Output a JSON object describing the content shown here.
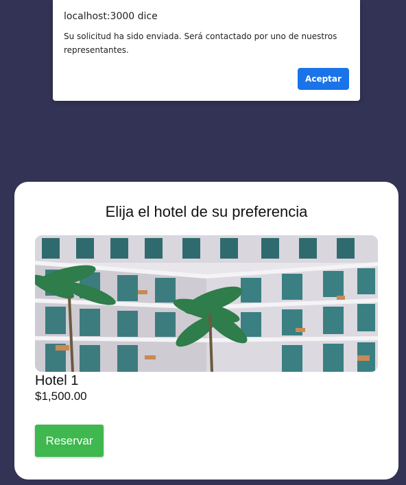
{
  "dialog": {
    "title": "localhost:3000 dice",
    "message": "Su solicitud ha sido enviada. Será contactado por uno de nuestros representantes.",
    "ok_label": "Aceptar"
  },
  "card": {
    "title": "Elija el hotel de su preferencia",
    "hotel": {
      "name": "Hotel 1",
      "price": "$1,500.00",
      "image": "hotel-photo"
    },
    "reserve_label": "Reservar"
  },
  "colors": {
    "page_background": "#333355",
    "dialog_button": "#1a73e8",
    "reserve_button": "#3fb84f"
  }
}
